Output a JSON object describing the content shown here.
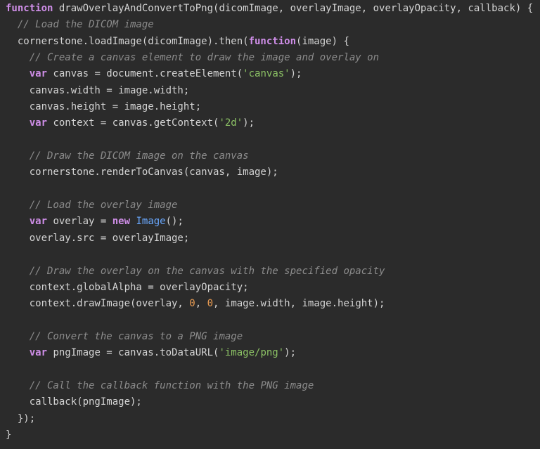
{
  "editor": {
    "language": "javascript",
    "colors": {
      "background": "#2b2b2b",
      "text": "#d4d4d4",
      "keyword": "#cf8ee8",
      "comment": "#8c8c8c",
      "string": "#8cc265",
      "number": "#e89b52",
      "class": "#6aa9ff"
    },
    "lines": [
      [
        {
          "t": "keyword",
          "v": "function"
        },
        {
          "t": "plain",
          "v": " drawOverlayAndConvertToPng(dicomImage, overlayImage, overlayOpacity, callback) {"
        }
      ],
      [
        {
          "t": "plain",
          "v": "  "
        },
        {
          "t": "comment",
          "v": "// Load the DICOM image"
        }
      ],
      [
        {
          "t": "plain",
          "v": "  cornerstone.loadImage(dicomImage).then("
        },
        {
          "t": "keyword",
          "v": "function"
        },
        {
          "t": "plain",
          "v": "(image) {"
        }
      ],
      [
        {
          "t": "plain",
          "v": "    "
        },
        {
          "t": "comment",
          "v": "// Create a canvas element to draw the image and overlay on"
        }
      ],
      [
        {
          "t": "plain",
          "v": "    "
        },
        {
          "t": "keyword",
          "v": "var"
        },
        {
          "t": "plain",
          "v": " canvas = document.createElement("
        },
        {
          "t": "string",
          "v": "'canvas'"
        },
        {
          "t": "plain",
          "v": ");"
        }
      ],
      [
        {
          "t": "plain",
          "v": "    canvas.width = image.width;"
        }
      ],
      [
        {
          "t": "plain",
          "v": "    canvas.height = image.height;"
        }
      ],
      [
        {
          "t": "plain",
          "v": "    "
        },
        {
          "t": "keyword",
          "v": "var"
        },
        {
          "t": "plain",
          "v": " context = canvas.getContext("
        },
        {
          "t": "string",
          "v": "'2d'"
        },
        {
          "t": "plain",
          "v": ");"
        }
      ],
      [],
      [
        {
          "t": "plain",
          "v": "    "
        },
        {
          "t": "comment",
          "v": "// Draw the DICOM image on the canvas"
        }
      ],
      [
        {
          "t": "plain",
          "v": "    cornerstone.renderToCanvas(canvas, image);"
        }
      ],
      [],
      [
        {
          "t": "plain",
          "v": "    "
        },
        {
          "t": "comment",
          "v": "// Load the overlay image"
        }
      ],
      [
        {
          "t": "plain",
          "v": "    "
        },
        {
          "t": "keyword",
          "v": "var"
        },
        {
          "t": "plain",
          "v": " overlay = "
        },
        {
          "t": "keyword",
          "v": "new"
        },
        {
          "t": "plain",
          "v": " "
        },
        {
          "t": "class",
          "v": "Image"
        },
        {
          "t": "plain",
          "v": "();"
        }
      ],
      [
        {
          "t": "plain",
          "v": "    overlay.src = overlayImage;"
        }
      ],
      [],
      [
        {
          "t": "plain",
          "v": "    "
        },
        {
          "t": "comment",
          "v": "// Draw the overlay on the canvas with the specified opacity"
        }
      ],
      [
        {
          "t": "plain",
          "v": "    context.globalAlpha = overlayOpacity;"
        }
      ],
      [
        {
          "t": "plain",
          "v": "    context.drawImage(overlay, "
        },
        {
          "t": "number",
          "v": "0"
        },
        {
          "t": "plain",
          "v": ", "
        },
        {
          "t": "number",
          "v": "0"
        },
        {
          "t": "plain",
          "v": ", image.width, image.height);"
        }
      ],
      [],
      [
        {
          "t": "plain",
          "v": "    "
        },
        {
          "t": "comment",
          "v": "// Convert the canvas to a PNG image"
        }
      ],
      [
        {
          "t": "plain",
          "v": "    "
        },
        {
          "t": "keyword",
          "v": "var"
        },
        {
          "t": "plain",
          "v": " pngImage = canvas.toDataURL("
        },
        {
          "t": "string",
          "v": "'image/png'"
        },
        {
          "t": "plain",
          "v": ");"
        }
      ],
      [],
      [
        {
          "t": "plain",
          "v": "    "
        },
        {
          "t": "comment",
          "v": "// Call the callback function with the PNG image"
        }
      ],
      [
        {
          "t": "plain",
          "v": "    callback(pngImage);"
        }
      ],
      [
        {
          "t": "plain",
          "v": "  });"
        }
      ],
      [
        {
          "t": "plain",
          "v": "}"
        }
      ]
    ]
  }
}
